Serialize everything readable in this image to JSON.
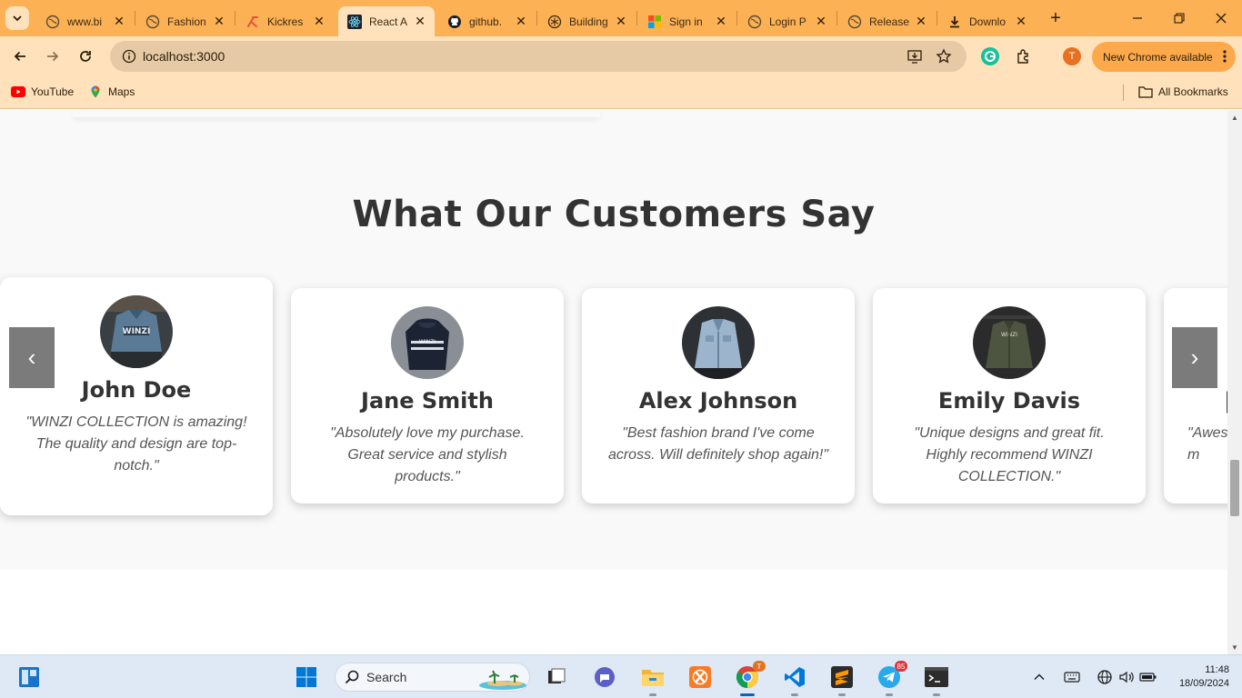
{
  "browser": {
    "tabs": [
      {
        "title": "www.bi",
        "icon": "globe-icon",
        "active": false
      },
      {
        "title": "Fashion",
        "icon": "globe-icon",
        "active": false
      },
      {
        "title": "Kickres",
        "icon": "kickresume-icon",
        "active": false
      },
      {
        "title": "React A",
        "icon": "react-icon",
        "active": true
      },
      {
        "title": "github.",
        "icon": "github-icon",
        "active": false
      },
      {
        "title": "Building",
        "icon": "chatgpt-icon",
        "active": false
      },
      {
        "title": "Sign in",
        "icon": "microsoft-icon",
        "active": false
      },
      {
        "title": "Login P",
        "icon": "globe-icon",
        "active": false
      },
      {
        "title": "Release",
        "icon": "globe-icon",
        "active": false
      },
      {
        "title": "Downlo",
        "icon": "download-icon",
        "active": false
      }
    ],
    "close_glyph": "✕",
    "new_tab_glyph": "+",
    "url": "localhost:3000",
    "profile_initial": "T",
    "update_label": "New Chrome available",
    "bookmarks": [
      {
        "label": "YouTube",
        "icon": "youtube-icon"
      },
      {
        "label": "Maps",
        "icon": "maps-icon"
      }
    ],
    "all_bookmarks_label": "All Bookmarks",
    "accent_color": "#fcb155"
  },
  "testimonials": {
    "title": "What Our Customers Say",
    "prev_glyph": "‹",
    "next_glyph": "›",
    "cards": [
      {
        "name": "John Doe",
        "quote": "\"WINZI COLLECTION is amazing! The quality and design are top-notch.\"",
        "avatar": "denim-jacket-avatar"
      },
      {
        "name": "Jane Smith",
        "quote": "\"Absolutely love my purchase. Great service and stylish products.\"",
        "avatar": "hoodie-avatar"
      },
      {
        "name": "Alex Johnson",
        "quote": "\"Best fashion brand I've come across. Will definitely shop again!\"",
        "avatar": "light-denim-avatar"
      },
      {
        "name": "Emily Davis",
        "quote": "\"Unique designs and great fit. Highly recommend WINZI COLLECTION.\"",
        "avatar": "olive-jacket-avatar"
      },
      {
        "name": "",
        "quote": "\"Aweso m",
        "avatar": ""
      }
    ]
  },
  "taskbar": {
    "search_label": "Search",
    "telegram_badge": "85",
    "chrome_badge": "T",
    "time": "11:48",
    "date": "18/09/2024"
  }
}
